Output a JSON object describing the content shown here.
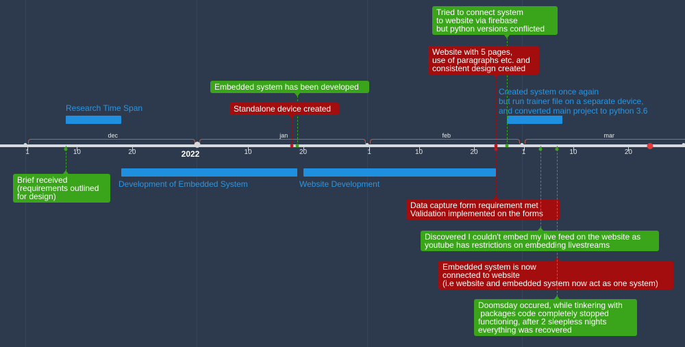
{
  "chart_data": {
    "type": "timeline",
    "year_label": "2022",
    "months": [
      {
        "label": "dec",
        "start": "2021-12-01",
        "end": "2021-12-31"
      },
      {
        "label": "jan",
        "start": "2022-01-01",
        "end": "2022-01-31"
      },
      {
        "label": "feb",
        "start": "2022-02-01",
        "end": "2022-02-28"
      },
      {
        "label": "mar",
        "start": "2022-03-01",
        "end": "2022-03-31"
      }
    ],
    "day_ticks": [
      "1",
      "10",
      "20"
    ],
    "spans": [
      {
        "label": "Research Time Span",
        "start": "2021-12-08",
        "end": "2021-12-18"
      },
      {
        "label": "Development of Embedded System",
        "start": "2021-12-18",
        "end": "2022-01-19"
      },
      {
        "label": "Website Development",
        "start": "2022-01-20",
        "end": "2022-02-24"
      },
      {
        "label": "Created system once again\nbut run trainer file on a separate device,\nand converted main project to python 3.6",
        "start": "2022-02-26",
        "end": "2022-03-08"
      }
    ],
    "events": [
      {
        "label": "Brief received\n(requirements outlined\nfor design)",
        "date": "2021-12-08",
        "color": "#3aa41a"
      },
      {
        "label": "Embedded system has been developed",
        "date": "2022-01-19",
        "color": "#3aa41a"
      },
      {
        "label": "Standalone device created",
        "date": "2022-01-18",
        "color": "#a30d0d"
      },
      {
        "label": "Tried to connect system\nto website via firebase\nbut python versions conflicted",
        "date": "2022-02-26",
        "color": "#3aa41a"
      },
      {
        "label": "Website with 5 pages,\nuse of paragraphs etc. and\nconsistent design created",
        "date": "2022-02-24",
        "color": "#a30d0d"
      },
      {
        "label": "Data capture form requirement met\nValidation implemented on the forms",
        "date": "2022-02-24",
        "color": "#a30d0d"
      },
      {
        "label": "Discovered I couldn't embed my live feed on the website as\nyoutube has restrictions on embedding livestreams",
        "date": "2022-03-04",
        "color": "#3aa41a"
      },
      {
        "label": "Embedded system is now\nconnected to website\n(i.e website and embedded system now act as one system)",
        "date": "2022-03-07",
        "color": "#a30d0d"
      },
      {
        "label": "Doomsday occured, while tinkering with\n packages code completely stopped\nfunctioning, after 2 sleepless nights\neverything was recovered",
        "date": "2022-03-07",
        "color": "#3aa41a"
      }
    ]
  }
}
